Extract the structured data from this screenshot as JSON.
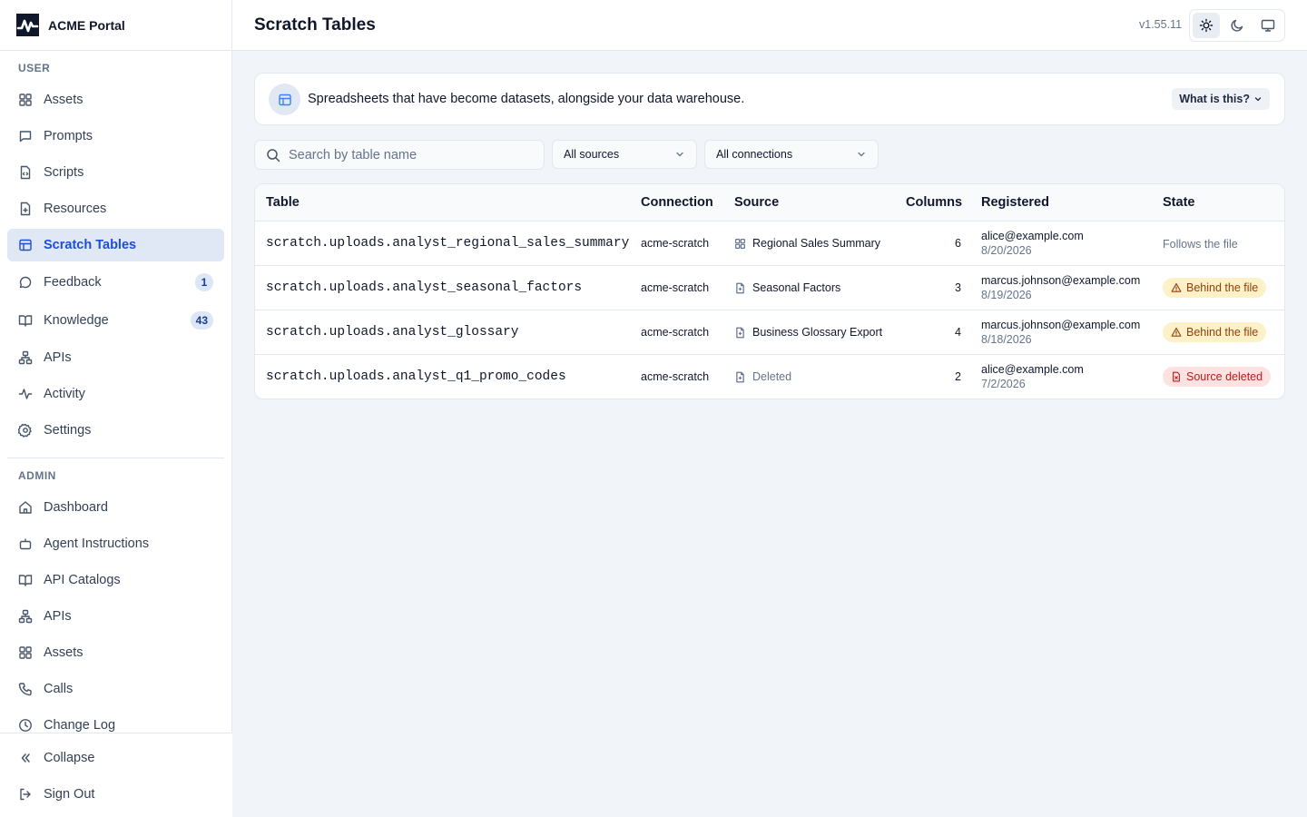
{
  "app": {
    "name": "ACME Portal",
    "version": "v1.55.11"
  },
  "sidebar": {
    "user_section": "USER",
    "user_items": [
      {
        "label": "Assets",
        "icon": "grid-icon"
      },
      {
        "label": "Prompts",
        "icon": "message-square-icon"
      },
      {
        "label": "Scripts",
        "icon": "file-code-icon"
      },
      {
        "label": "Resources",
        "icon": "file-plus-icon"
      },
      {
        "label": "Scratch Tables",
        "icon": "table-icon",
        "active": true
      },
      {
        "label": "Feedback",
        "icon": "message-circle-icon",
        "badge": "1"
      },
      {
        "label": "Knowledge",
        "icon": "book-open-icon",
        "badge": "43"
      },
      {
        "label": "APIs",
        "icon": "network-icon"
      },
      {
        "label": "Activity",
        "icon": "activity-icon"
      },
      {
        "label": "Settings",
        "icon": "gear-icon"
      }
    ],
    "admin_section": "ADMIN",
    "admin_items": [
      {
        "label": "Dashboard",
        "icon": "home-icon"
      },
      {
        "label": "Agent Instructions",
        "icon": "bot-icon"
      },
      {
        "label": "API Catalogs",
        "icon": "book-open-icon"
      },
      {
        "label": "APIs",
        "icon": "network-icon"
      },
      {
        "label": "Assets",
        "icon": "grid-icon"
      },
      {
        "label": "Calls",
        "icon": "phone-icon"
      },
      {
        "label": "Change Log",
        "icon": "clock-icon"
      }
    ],
    "collapse": "Collapse",
    "sign_out": "Sign Out"
  },
  "header": {
    "title": "Scratch Tables",
    "theme_buttons": [
      "sun-icon",
      "moon-icon",
      "monitor-icon"
    ],
    "active_theme": "light"
  },
  "banner": {
    "text": "Spreadsheets that have become datasets, alongside your data warehouse.",
    "button": "What is this?"
  },
  "filters": {
    "search_placeholder": "Search by table name",
    "sources": "All sources",
    "connections": "All connections"
  },
  "table": {
    "headers": [
      "Table",
      "Connection",
      "Source",
      "Columns",
      "Registered",
      "State"
    ],
    "rows": [
      {
        "table": "scratch.uploads.analyst_regional_sales_summary",
        "connection": "acme-scratch",
        "source": "Regional Sales Summary",
        "source_icon": "grid-icon",
        "columns": "6",
        "email": "alice@example.com",
        "date": "8/20/2026",
        "state": "Follows the file",
        "state_kind": "plain"
      },
      {
        "table": "scratch.uploads.analyst_seasonal_factors",
        "connection": "acme-scratch",
        "source": "Seasonal Factors",
        "source_icon": "file-icon",
        "columns": "3",
        "email": "marcus.johnson@example.com",
        "date": "8/19/2026",
        "state": "Behind the file",
        "state_kind": "warn"
      },
      {
        "table": "scratch.uploads.analyst_glossary",
        "connection": "acme-scratch",
        "source": "Business Glossary Export",
        "source_icon": "file-icon",
        "columns": "4",
        "email": "marcus.johnson@example.com",
        "date": "8/18/2026",
        "state": "Behind the file",
        "state_kind": "warn"
      },
      {
        "table": "scratch.uploads.analyst_q1_promo_codes",
        "connection": "acme-scratch",
        "source": "Deleted",
        "source_icon": "file-icon",
        "columns": "2",
        "email": "alice@example.com",
        "date": "7/2/2026",
        "state": "Source deleted",
        "state_kind": "err"
      }
    ]
  },
  "colors": {
    "accent": "#1d4ed8",
    "active_bg": "#e0e7f5",
    "warn_bg": "#fdf1c7",
    "warn_fg": "#92400e",
    "err_bg": "#fde2e2",
    "err_fg": "#b91c1c"
  }
}
